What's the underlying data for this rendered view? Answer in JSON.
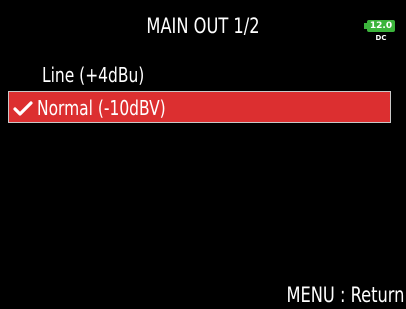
{
  "header": {
    "title": "MAIN OUT 1/2",
    "battery": {
      "level_text": "12.0",
      "source_text": "DC",
      "icon": "battery-icon",
      "color": "#3cb43c"
    }
  },
  "menu": {
    "items": [
      {
        "label": "Line (+4dBu)",
        "selected": false
      },
      {
        "label": "Normal (-10dBV)",
        "selected": true,
        "icon": "checkmark-icon"
      }
    ],
    "selection_color": "#dc2f30"
  },
  "footer": {
    "hint": "MENU : Return"
  }
}
